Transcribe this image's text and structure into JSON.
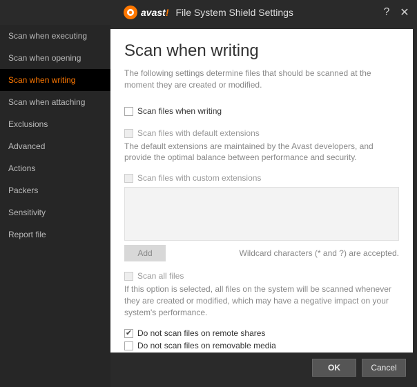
{
  "titlebar": {
    "brand": "avast",
    "brand_excl": "!",
    "window_title": "File System Shield Settings",
    "help_label": "?",
    "close_label": "✕"
  },
  "sidebar": {
    "items": [
      {
        "label": "Scan when executing"
      },
      {
        "label": "Scan when opening"
      },
      {
        "label": "Scan when writing"
      },
      {
        "label": "Scan when attaching"
      },
      {
        "label": "Exclusions"
      },
      {
        "label": "Advanced"
      },
      {
        "label": "Actions"
      },
      {
        "label": "Packers"
      },
      {
        "label": "Sensitivity"
      },
      {
        "label": "Report file"
      }
    ],
    "active_index": 2
  },
  "page": {
    "title": "Scan when writing",
    "description": "The following settings determine files that should be scanned at the moment they are created or modified.",
    "opt_scan_writing": "Scan files when writing",
    "opt_default_ext": "Scan files with default extensions",
    "opt_default_ext_desc": "The default extensions are maintained by the Avast developers, and provide the optimal balance between performance and security.",
    "opt_custom_ext": "Scan files with custom extensions",
    "add_button": "Add",
    "wildcard_note": "Wildcard characters (* and ?) are accepted.",
    "opt_scan_all": "Scan all files",
    "opt_scan_all_desc": "If this option is selected, all files on the system will be scanned whenever they are created or modified, which may have a negative impact on your system's performance.",
    "opt_no_remote": "Do not scan files on remote shares",
    "opt_no_removable": "Do not scan files on removable media"
  },
  "footer": {
    "ok": "OK",
    "cancel": "Cancel"
  }
}
